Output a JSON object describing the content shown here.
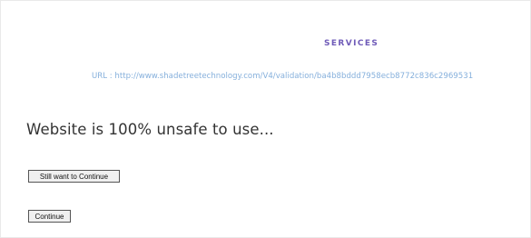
{
  "page": {
    "services_heading": "SERVICES",
    "url_text": "URL : http://www.shadetreetechnology.com/V4/validation/ba4b8bddd7958ecb8772c836c2969531",
    "warning_title": "Website is 100% unsafe to use...",
    "buttons": {
      "still_continue": "Still want to Continue",
      "continue": "Continue"
    }
  },
  "colors": {
    "heading": "#6f5bb8",
    "url": "#86b0dc",
    "title": "#333333"
  }
}
